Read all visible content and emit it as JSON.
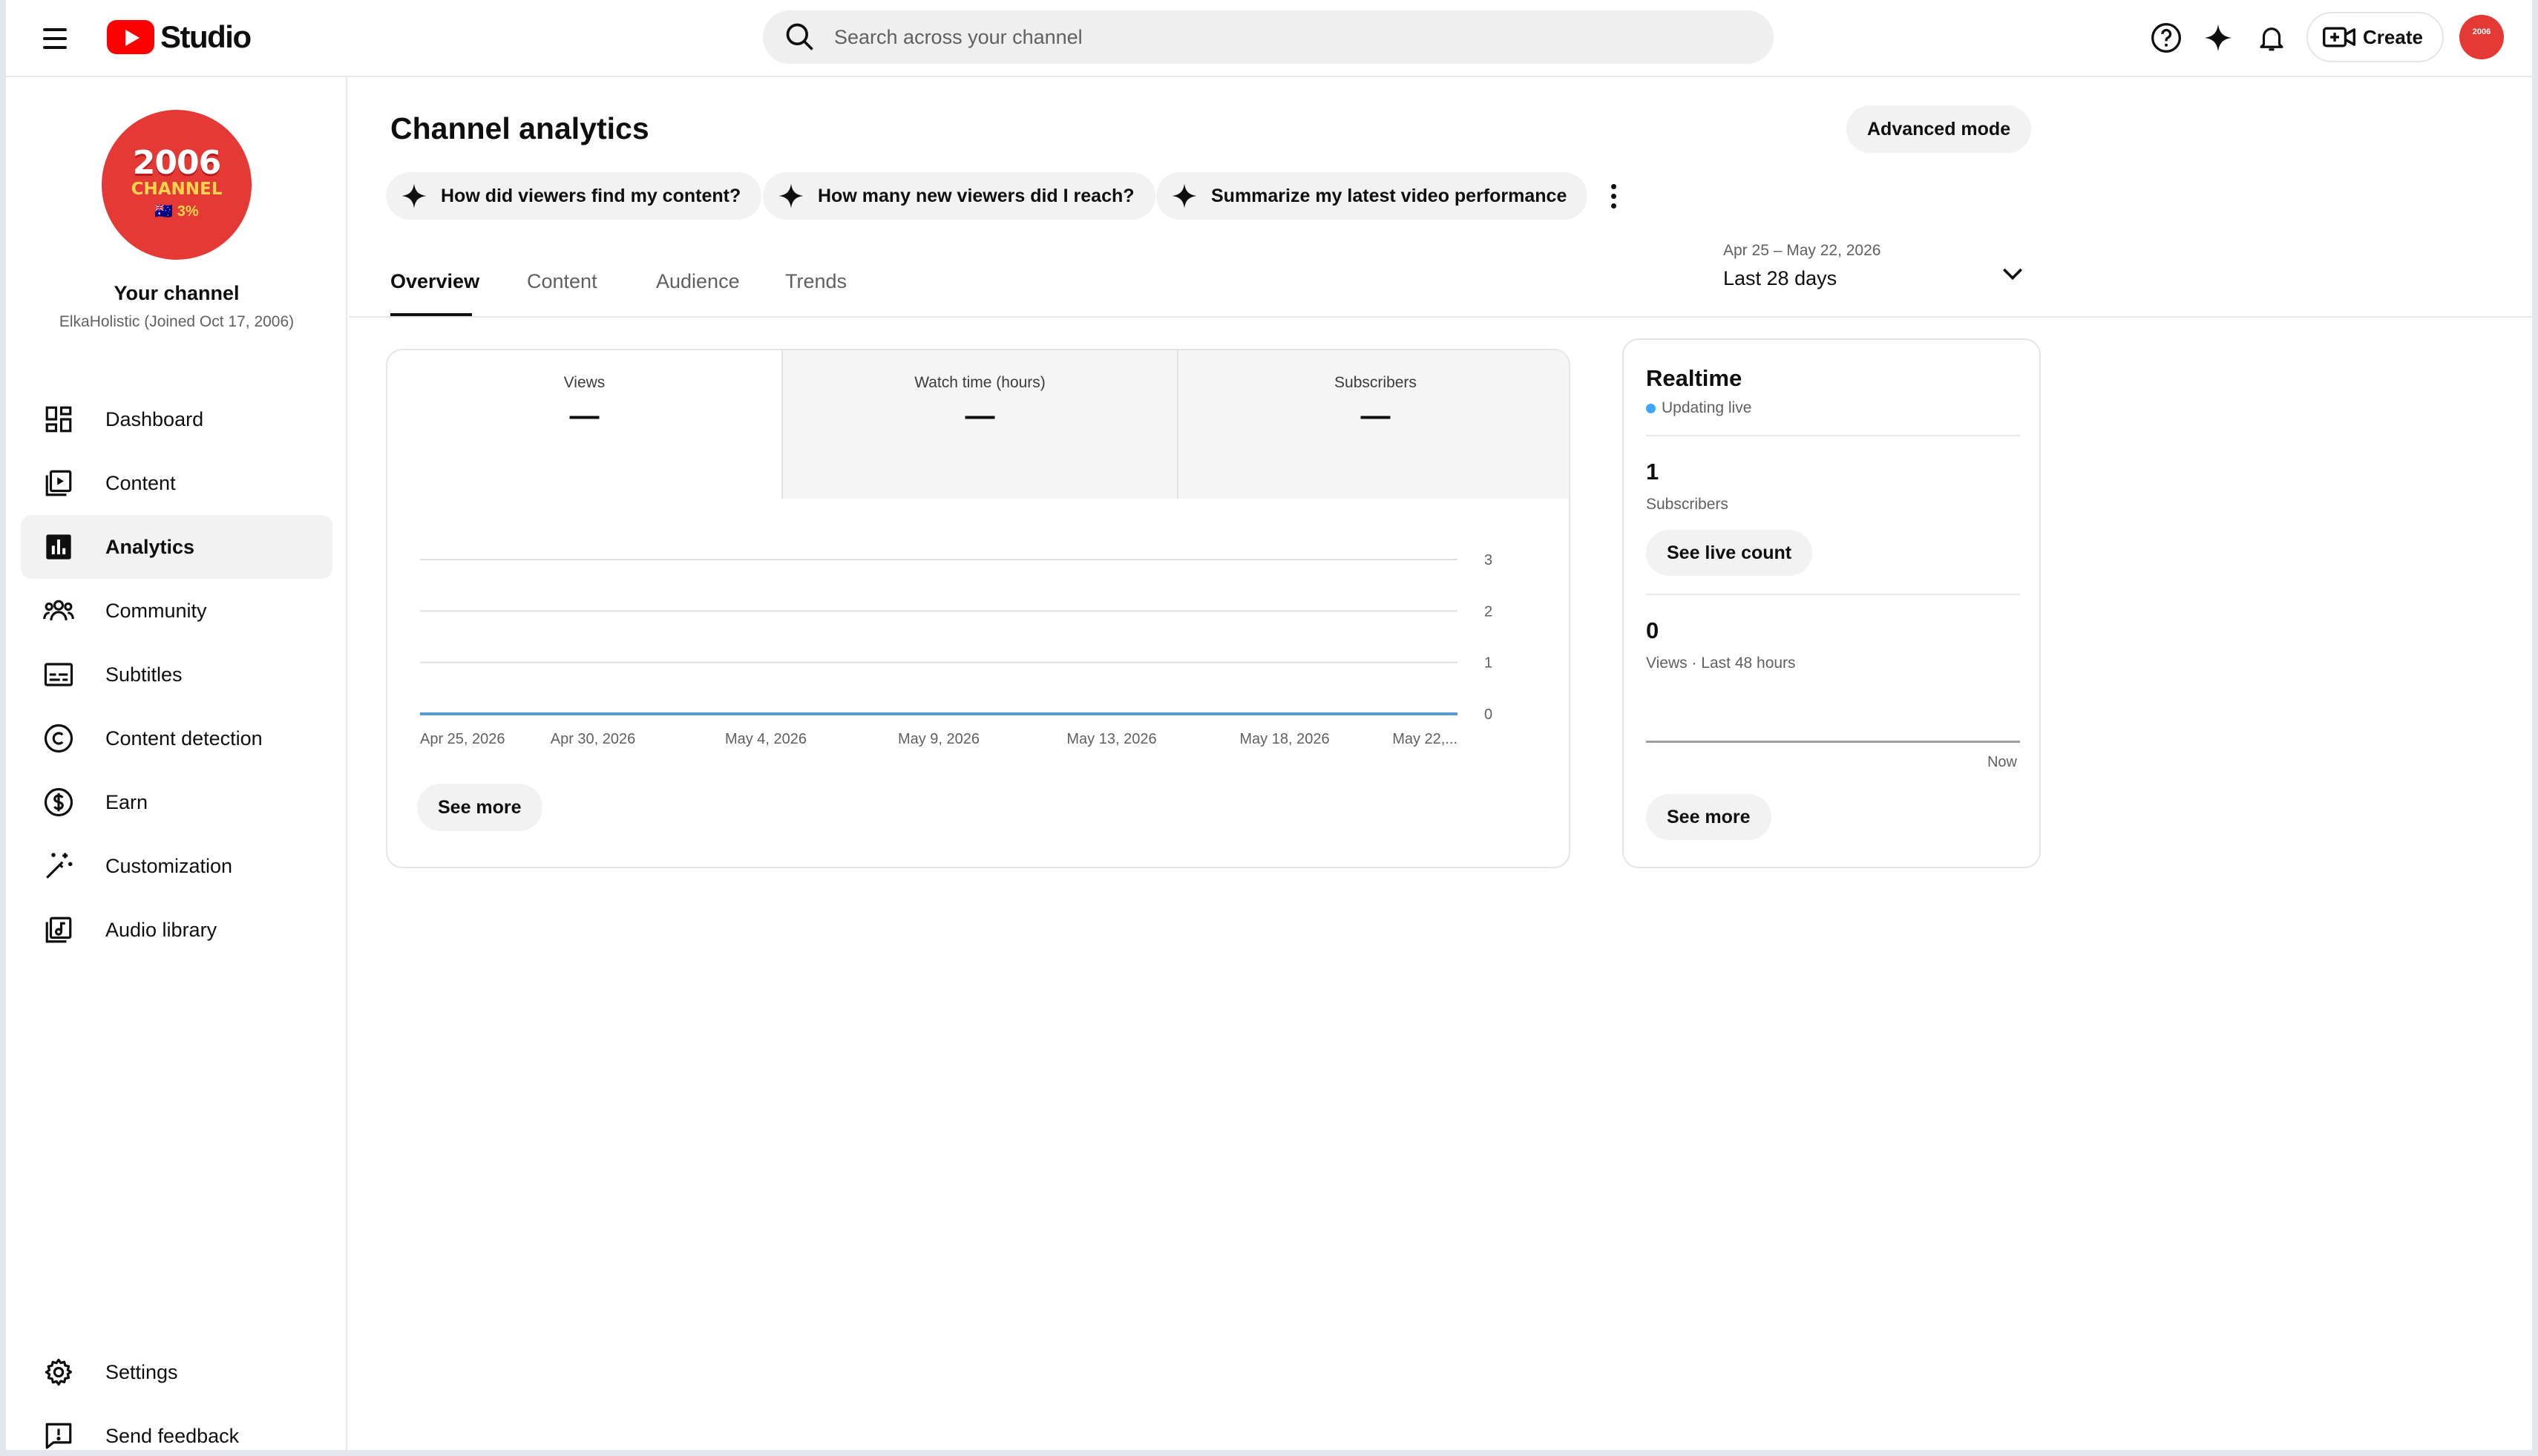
{
  "header": {
    "app_name": "Studio",
    "search_placeholder": "Search across your channel",
    "create_label": "Create",
    "avatar_text": "2006"
  },
  "sidebar": {
    "channel_title": "Your channel",
    "channel_meta": "ElkaHolistic (Joined Oct 17, 2006)",
    "avatar_line1": "2006",
    "avatar_line2": "CHANNEL",
    "avatar_line3": "🇦🇺 3%",
    "items": [
      {
        "label": "Dashboard",
        "icon": "dashboard-icon"
      },
      {
        "label": "Content",
        "icon": "content-icon"
      },
      {
        "label": "Analytics",
        "icon": "analytics-icon",
        "active": true
      },
      {
        "label": "Community",
        "icon": "community-icon"
      },
      {
        "label": "Subtitles",
        "icon": "subtitles-icon"
      },
      {
        "label": "Content detection",
        "icon": "copyright-icon"
      },
      {
        "label": "Earn",
        "icon": "dollar-icon"
      },
      {
        "label": "Customization",
        "icon": "magic-wand-icon"
      },
      {
        "label": "Audio library",
        "icon": "audio-library-icon"
      }
    ],
    "footer_items": [
      {
        "label": "Settings",
        "icon": "gear-icon"
      },
      {
        "label": "Send feedback",
        "icon": "feedback-icon"
      }
    ]
  },
  "main": {
    "title": "Channel analytics",
    "advanced_mode_label": "Advanced mode",
    "chips": [
      "How did viewers find my content?",
      "How many new viewers did I reach?",
      "Summarize my latest video performance"
    ],
    "tabs": [
      "Overview",
      "Content",
      "Audience",
      "Trends"
    ],
    "active_tab": "Overview",
    "date_range": {
      "dates": "Apr 25 – May 22, 2026",
      "period": "Last 28 days"
    },
    "metrics": [
      {
        "label": "Views",
        "value": "—"
      },
      {
        "label": "Watch time (hours)",
        "value": "—"
      },
      {
        "label": "Subscribers",
        "value": "—"
      }
    ],
    "see_more_label": "See more"
  },
  "chart_data": {
    "type": "line",
    "x": [
      "Apr 25, 2026",
      "Apr 30, 2026",
      "May 4, 2026",
      "May 9, 2026",
      "May 13, 2026",
      "May 18, 2026",
      "May 22,..."
    ],
    "series": [
      {
        "values": [
          0,
          0,
          0,
          0,
          0,
          0,
          0
        ]
      }
    ],
    "yticks": [
      0,
      1,
      2,
      3
    ],
    "ylim": [
      0,
      3
    ],
    "grid": true,
    "line_color": "#5b9bd5"
  },
  "realtime": {
    "title": "Realtime",
    "status": "Updating live",
    "subscribers_value": "1",
    "subscribers_label": "Subscribers",
    "live_count_label": "See live count",
    "views_value": "0",
    "views_label": "Views · Last 48 hours",
    "now_label": "Now",
    "see_more_label": "See more"
  }
}
